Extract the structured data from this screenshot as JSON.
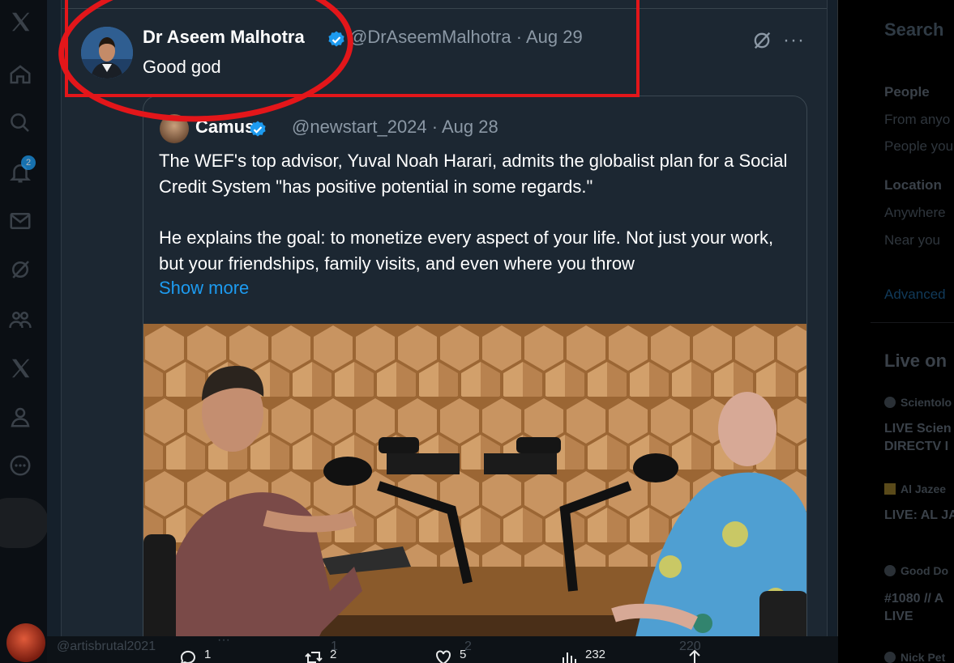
{
  "nav": {
    "notification_count": "2",
    "items": [
      "x-logo",
      "home",
      "explore",
      "notifications",
      "messages",
      "grok",
      "communities",
      "premium",
      "profile",
      "more"
    ]
  },
  "tweet": {
    "author_name": "Dr Aseem Malhotra",
    "handle_date": "@DrAseemMalhotra · Aug 29",
    "text": "Good god",
    "more": "···"
  },
  "quote": {
    "author_name": "Camus",
    "handle_date": "@newstart_2024 · Aug 28",
    "paragraph1": "The WEF's top advisor, Yuval Noah Harari, admits the globalist plan for a Social Credit System \"has positive potential in some regards.\"",
    "paragraph2": "He explains the goal: to monetize every aspect of your life. Not just your work, but your friendships, family visits, and even where you throw",
    "show_more": "Show more"
  },
  "underlying_row": {
    "handle": "@artisbrutal2021",
    "more": "···",
    "replies": "1",
    "reposts": "2",
    "likes": "5",
    "views": "232",
    "bg_views": "220"
  },
  "sidebar": {
    "search_title": "Search",
    "people_heading": "People",
    "people_options": [
      "From anyo",
      "People you"
    ],
    "location_heading": "Location",
    "location_options": [
      "Anywhere",
      "Near you"
    ],
    "advanced": "Advanced",
    "live_heading": "Live on",
    "live_items": [
      {
        "source": "Scientolo",
        "title1": "LIVE Scien",
        "title2": "DIRECTV I"
      },
      {
        "source": "Al Jazee",
        "title1": "LIVE: AL JA",
        "title2": ""
      },
      {
        "source": "Good Do",
        "title1": "#1080 // A",
        "title2": "LIVE"
      },
      {
        "source": "Nick Pet",
        "title1": "",
        "title2": ""
      }
    ]
  },
  "colors": {
    "accent": "#1d9bf0",
    "annotation_red": "#e3161a",
    "background": "#15202b"
  }
}
